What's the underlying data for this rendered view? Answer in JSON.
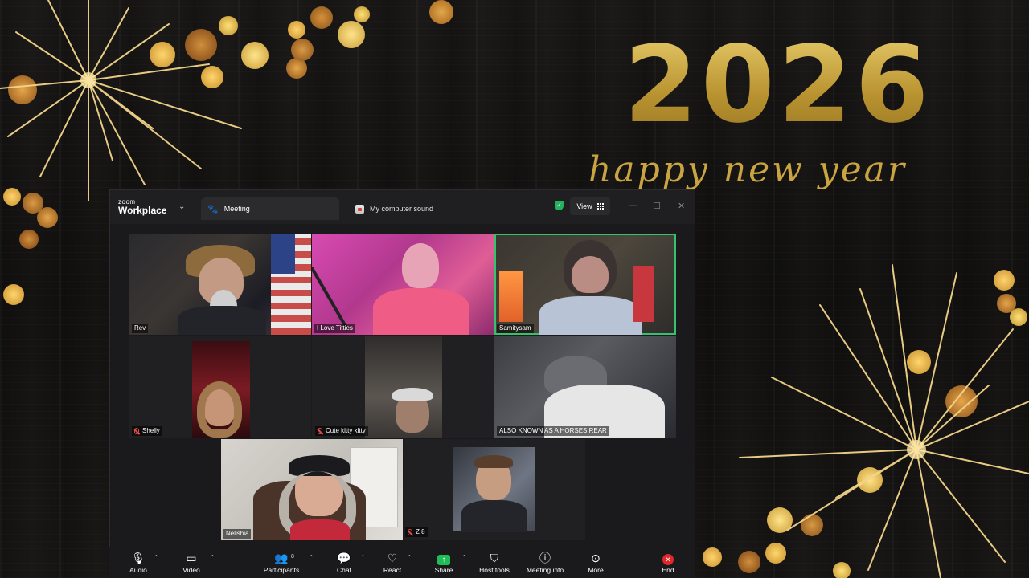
{
  "background": {
    "year": "2026",
    "greeting": "happy new year"
  },
  "window": {
    "brand_small": "zoom",
    "brand_big": "Workplace",
    "tab_meeting": "Meeting",
    "tab_sound": "My computer sound",
    "view_label": "View"
  },
  "participants": [
    {
      "name": "Rev",
      "muted": false
    },
    {
      "name": "I Love Titties",
      "muted": false
    },
    {
      "name": "Samitysam",
      "muted": false,
      "active_speaker": true
    },
    {
      "name": "Shelly",
      "muted": true
    },
    {
      "name": "Cute kitty kitty",
      "muted": true
    },
    {
      "name": "ALSO KNOWN AS A HORSES REAR",
      "muted": false
    },
    {
      "name": "Nelishia",
      "muted": false
    },
    {
      "name": "Z 8",
      "muted": true
    }
  ],
  "toolbar": {
    "audio": "Audio",
    "video": "Video",
    "participants": "Participants",
    "participants_count": "8",
    "chat": "Chat",
    "react": "React",
    "share": "Share",
    "host_tools": "Host tools",
    "meeting_info": "Meeting info",
    "more": "More",
    "end": "End"
  },
  "colors": {
    "gold": "#c9a441",
    "active_speaker": "#35c16d",
    "share_green": "#1fbd57",
    "end_red": "#e02828"
  }
}
